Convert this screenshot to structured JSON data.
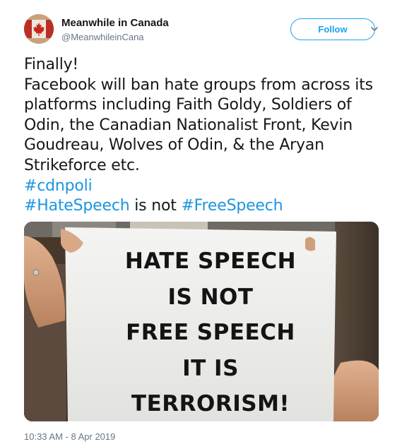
{
  "author": {
    "name": "Meanwhile in Canada",
    "handle": "@MeanwhileinCana",
    "avatar_icon": "canadian-flag-maple-leaf"
  },
  "actions": {
    "follow_label": "Follow",
    "more_icon": "chevron-down-icon"
  },
  "tweet": {
    "lines": [
      "Finally!",
      "Facebook will ban hate groups from across its",
      "platforms including Faith Goldy, Soldiers of",
      "Odin, the Canadian Nationalist Front, Kevin",
      "Goudreau, Wolves of Odin, & the Aryan",
      "Strikeforce etc."
    ],
    "hashtag_cdnpoli": "#cdnpoli",
    "hashtag_hatespeech": "#HateSpeech",
    "connector": " is not ",
    "hashtag_freespeech": "#FreeSpeech"
  },
  "media": {
    "sign_lines": [
      "HATE SPEECH",
      "IS NOT",
      "FREE SPEECH",
      "IT IS",
      "TERRORISM!"
    ]
  },
  "timestamp": "10:33 AM - 8 Apr 2019",
  "colors": {
    "link": "#1b95e0",
    "accent": "#1da1f2",
    "secondary_text": "#657786",
    "flag_red": "#d52b1e"
  }
}
